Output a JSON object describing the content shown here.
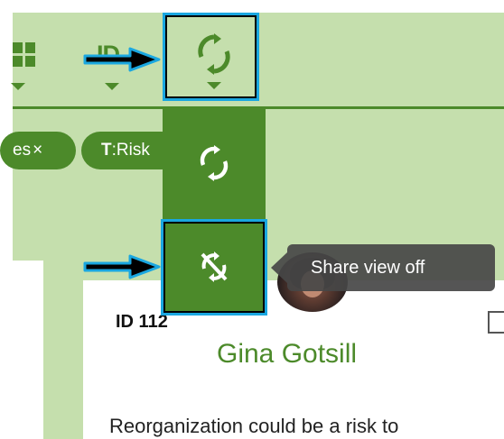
{
  "toolbar": {
    "grid_icon": "grid-view-icon",
    "sort_label": "ID",
    "sync_icon": "sync-icon"
  },
  "filters": [
    {
      "label": "es",
      "close": "×"
    },
    {
      "prefix": "T",
      "label": ":Risk"
    }
  ],
  "dropdown": {
    "items": [
      {
        "icon": "sync-icon"
      },
      {
        "icon": "sync-disabled-icon"
      }
    ]
  },
  "tooltip": {
    "text": "Share view off"
  },
  "card": {
    "id": "ID 112",
    "name": "Gina Gotsill",
    "description": "Reorganization could be a risk to"
  },
  "colors": {
    "accent": "#4c8a2a",
    "toolbar_bg": "#c5dfad",
    "highlight": "#1aa7e0"
  }
}
